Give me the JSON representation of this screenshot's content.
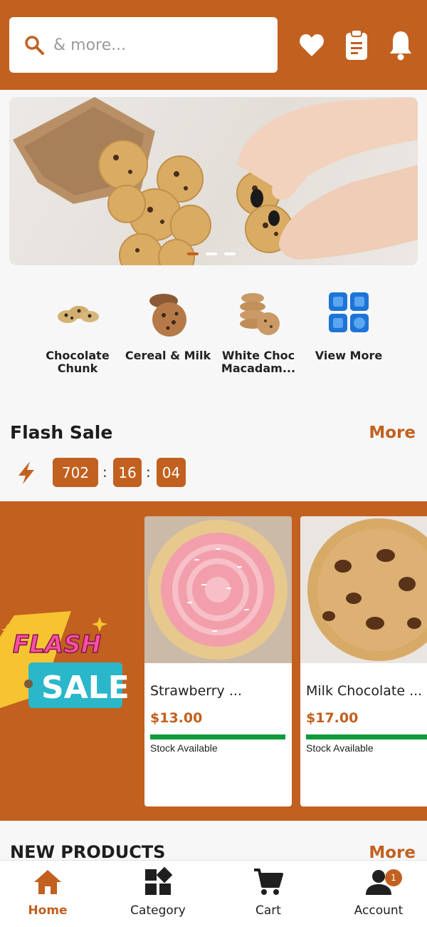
{
  "search": {
    "placeholder": "& more..."
  },
  "header_icons": [
    "heart-icon",
    "clipboard-icon",
    "bell-icon"
  ],
  "banner": {
    "image": "cookies-bag-hands-photo",
    "slides": 3,
    "active_slide": 0
  },
  "categories": [
    {
      "label": "Chocolate Chunk",
      "icon": "chocolate-chunk-cookies"
    },
    {
      "label": "Cereal & Milk",
      "icon": "cereal-milk-cookies"
    },
    {
      "label": "White Choc Macadam...",
      "icon": "white-choc-cookie-stack"
    },
    {
      "label": "View More",
      "icon": "grid-apps-icon"
    }
  ],
  "flash_sale": {
    "title": "Flash Sale",
    "more_label": "More",
    "timer": {
      "hours": "702",
      "minutes": "16",
      "seconds": "04",
      "separator": ":"
    },
    "promo_art": {
      "line1": "FLASH",
      "line2": "SALE"
    },
    "products": [
      {
        "name": "Strawberry ...",
        "price": "$13.00",
        "stock": "Stock Available",
        "image": "strawberry-frosted-cookie"
      },
      {
        "name": "Milk Chocolate ...",
        "price": "$17.00",
        "stock": "Stock Available",
        "image": "milk-chocolate-chip-cookie"
      }
    ]
  },
  "new_products": {
    "title": "NEW PRODUCTS",
    "more_label": "More"
  },
  "nav": {
    "items": [
      {
        "label": "Home",
        "icon": "home-icon",
        "active": true
      },
      {
        "label": "Category",
        "icon": "category-icon",
        "active": false
      },
      {
        "label": "Cart",
        "icon": "cart-icon",
        "active": false
      },
      {
        "label": "Account",
        "icon": "account-icon",
        "active": false,
        "badge": "1"
      }
    ]
  },
  "colors": {
    "brand": "#c2601f",
    "stock_bar": "#0d9a3a",
    "grid_icon": "#1e74d6"
  }
}
